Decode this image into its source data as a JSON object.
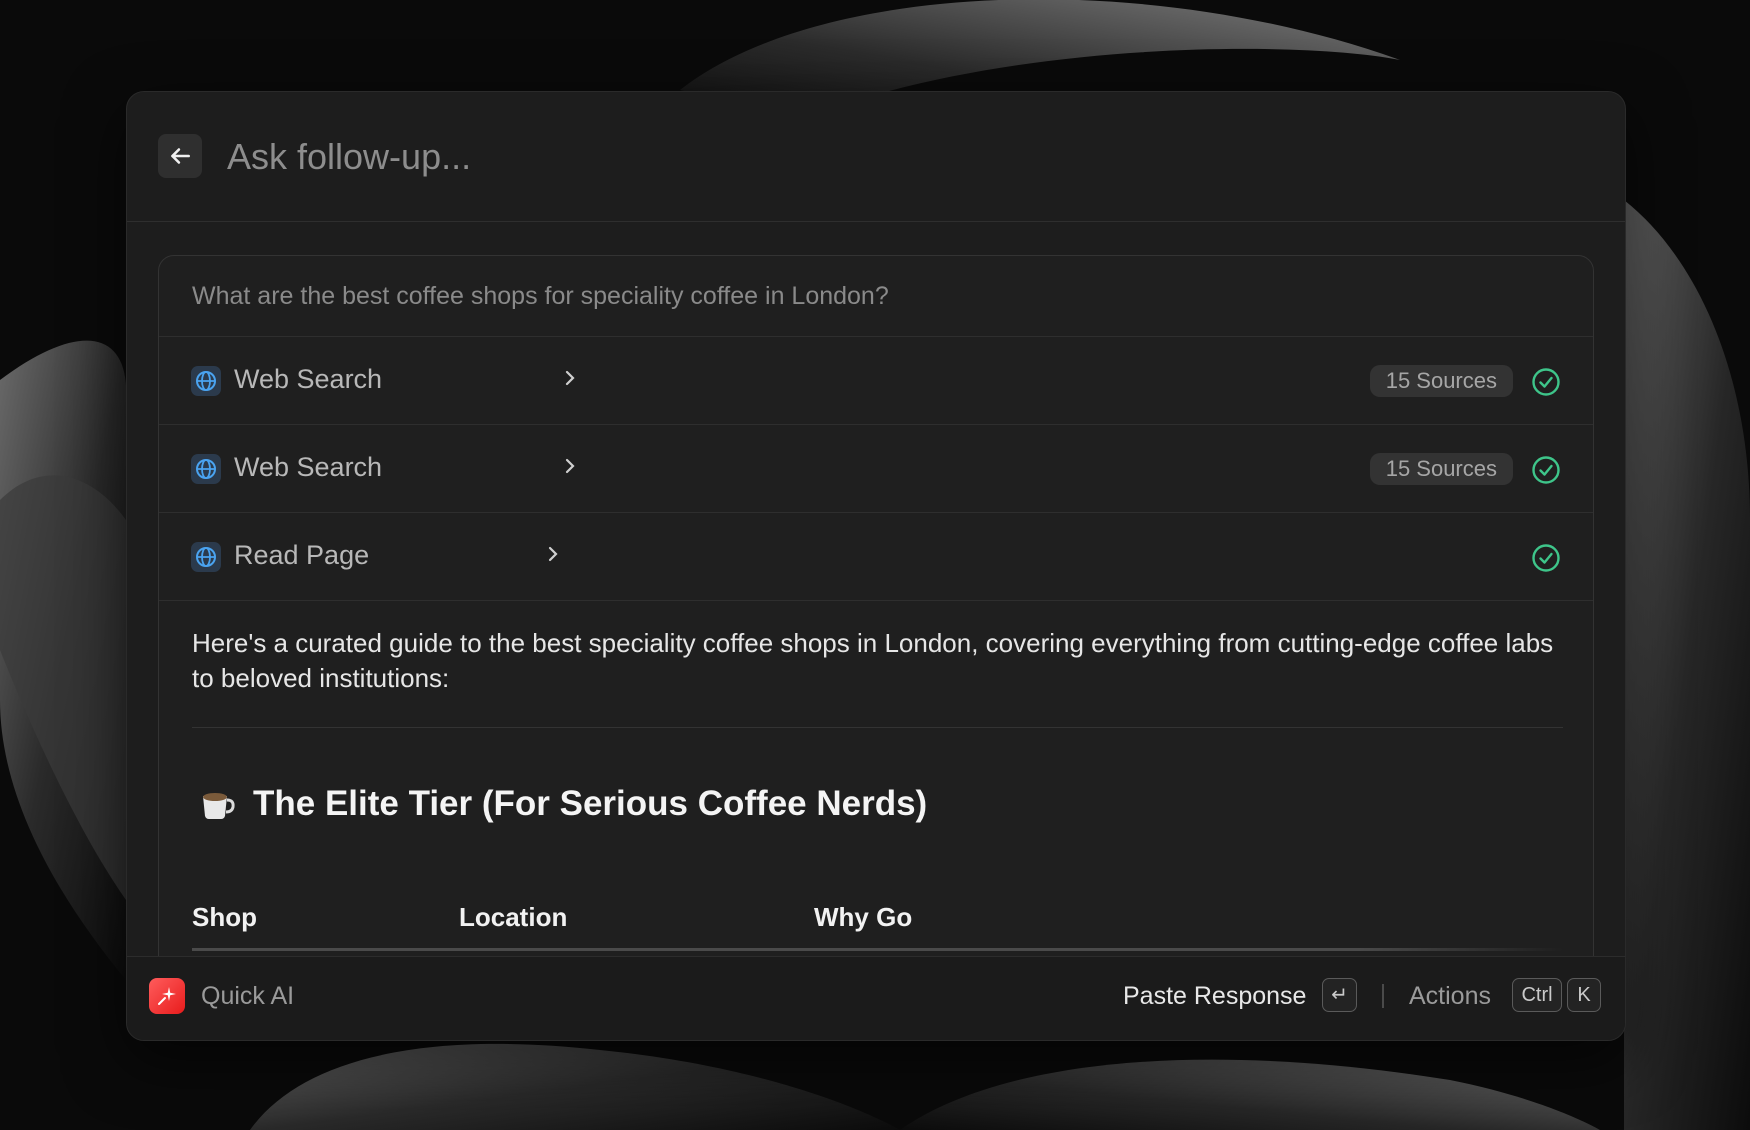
{
  "header": {
    "placeholder": "Ask follow-up...",
    "back_icon": "arrow-left-icon"
  },
  "conversation": {
    "question": "What are the best coffee shops for speciality coffee in London?",
    "steps": [
      {
        "label": "Web Search",
        "icon": "globe-icon",
        "sources": "15 Sources",
        "status": "done"
      },
      {
        "label": "Web Search",
        "icon": "globe-icon",
        "sources": "15 Sources",
        "status": "done"
      },
      {
        "label": "Read Page",
        "icon": "globe-icon",
        "sources": "",
        "status": "done"
      }
    ],
    "answer_intro": "Here's a curated guide to the best speciality coffee shops in London, covering everything from cutting-edge coffee labs to beloved institutions:",
    "section_title": "The Elite Tier (For Serious Coffee Nerds)",
    "section_icon": "coffee-cup-icon",
    "table_headers": [
      "Shop",
      "Location",
      "Why Go"
    ]
  },
  "footer": {
    "app_name": "Quick AI",
    "paste_label": "Paste Response",
    "paste_key": "↵",
    "actions_label": "Actions",
    "actions_keys": [
      "Ctrl",
      "K"
    ]
  },
  "colors": {
    "accent_check": "#3ec58a",
    "globe_blue": "#3b8fe0",
    "app_icon_red": "#e81c1c"
  }
}
